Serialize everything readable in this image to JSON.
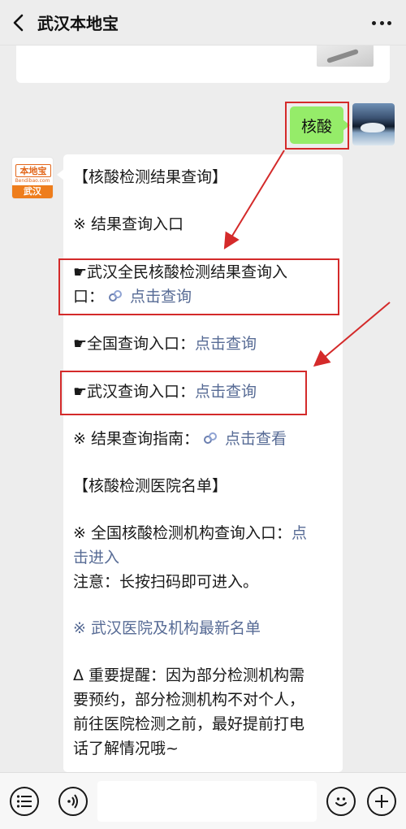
{
  "header": {
    "title": "武汉本地宝",
    "back_icon": "chevron-left-icon",
    "more_icon": "more-dots-icon"
  },
  "user_message": {
    "text": "核酸"
  },
  "bot_avatar": {
    "logo_text": "本地宝",
    "site_text": "Bendibao.com",
    "city_text": "武汉"
  },
  "bot_message": {
    "heading1": "【核酸检测结果查询】",
    "section1": "※ 结果查询入口",
    "entry1_prefix": "☛武汉全民核酸检测结果查询入",
    "entry1_suffix": "口：",
    "entry1_link": "点击查询",
    "entry2_label": "☛全国查询入口：",
    "entry2_link": "点击查询",
    "entry3_label": "☛武汉查询入口：",
    "entry3_link": "点击查询",
    "guide_label": "※ 结果查询指南：",
    "guide_link": "点击查看",
    "heading2": "【核酸检测医院名单】",
    "institution_label": "※ 全国核酸检测机构查询入口：",
    "institution_link_part1": "点",
    "institution_link_part2": "击进入",
    "note": "注意：长按扫码即可进入。",
    "hospital_prefix": "※ ",
    "hospital_link": "武汉医院及机构最新名单",
    "reminder_line1": "Δ 重要提醒：因为部分检测机构需",
    "reminder_line2": "要预约，部分检测机构不对个人，",
    "reminder_line3": "前往医院检测之前，最好提前打电",
    "reminder_line4": "话了解情况哦~"
  },
  "bottom_bar": {
    "menu_icon": "menu-list-icon",
    "voice_icon": "voice-icon",
    "emoji_icon": "emoji-icon",
    "add_icon": "add-icon"
  },
  "colors": {
    "link": "#576b95",
    "user_bubble": "#95ec69",
    "highlight": "#d42a2a",
    "background": "#ededed"
  }
}
